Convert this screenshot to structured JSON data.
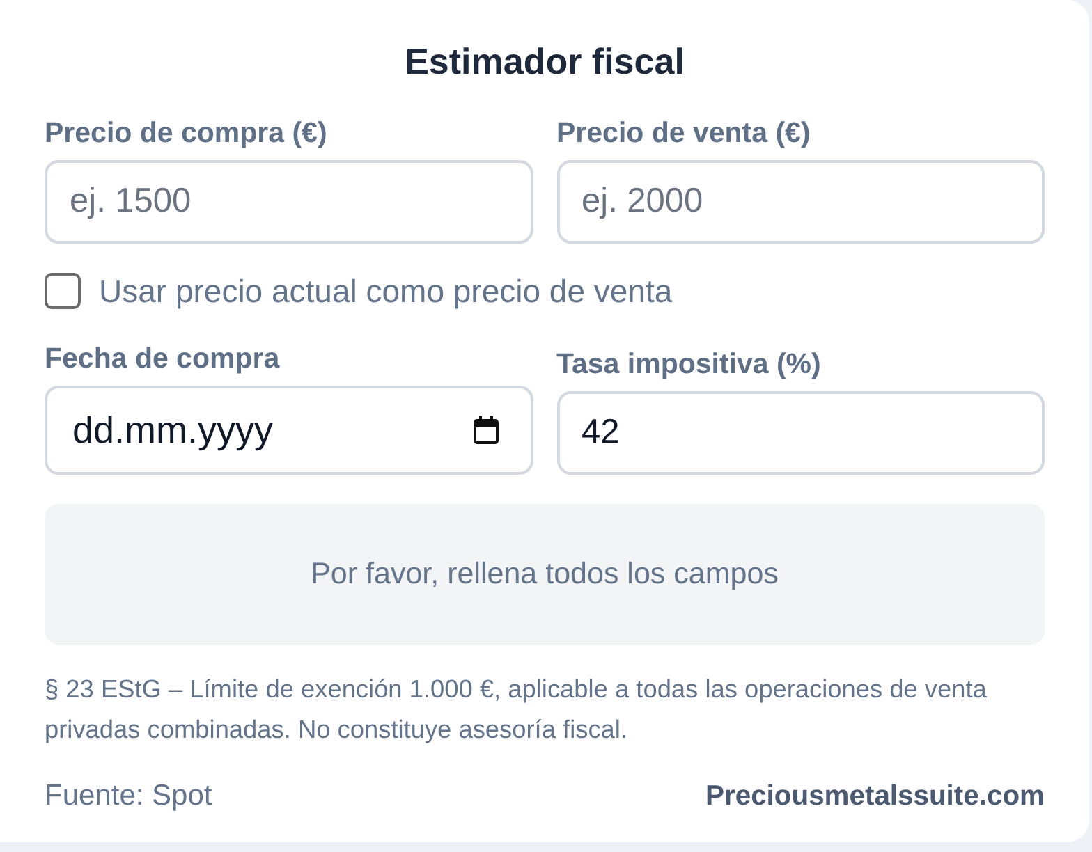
{
  "title": "Estimador fiscal",
  "price_fields": [
    {
      "label": "Precio de compra (€)",
      "kind": "text",
      "placeholder": "ej. 1500"
    },
    {
      "label": "Precio de venta (€)",
      "kind": "text",
      "placeholder": "ej. 2000"
    }
  ],
  "checkbox": {
    "label": "Usar precio actual como precio de venta",
    "checked": false
  },
  "detail_fields": [
    {
      "label": "Fecha de compra",
      "kind": "date",
      "placeholder": "dd.mm.yyyy"
    },
    {
      "label": "Tasa impositiva (%)",
      "kind": "text",
      "value": "42"
    }
  ],
  "message": "Por favor, rellena todos los campos",
  "disclaimer": "§ 23 EStG – Límite de exención 1.000 €, aplicable a todas las operaciones de venta privadas combinadas. No constituye asesoría fiscal.",
  "footer": {
    "source": "Fuente: Spot",
    "brand": "Preciousmetalssuite.com"
  }
}
